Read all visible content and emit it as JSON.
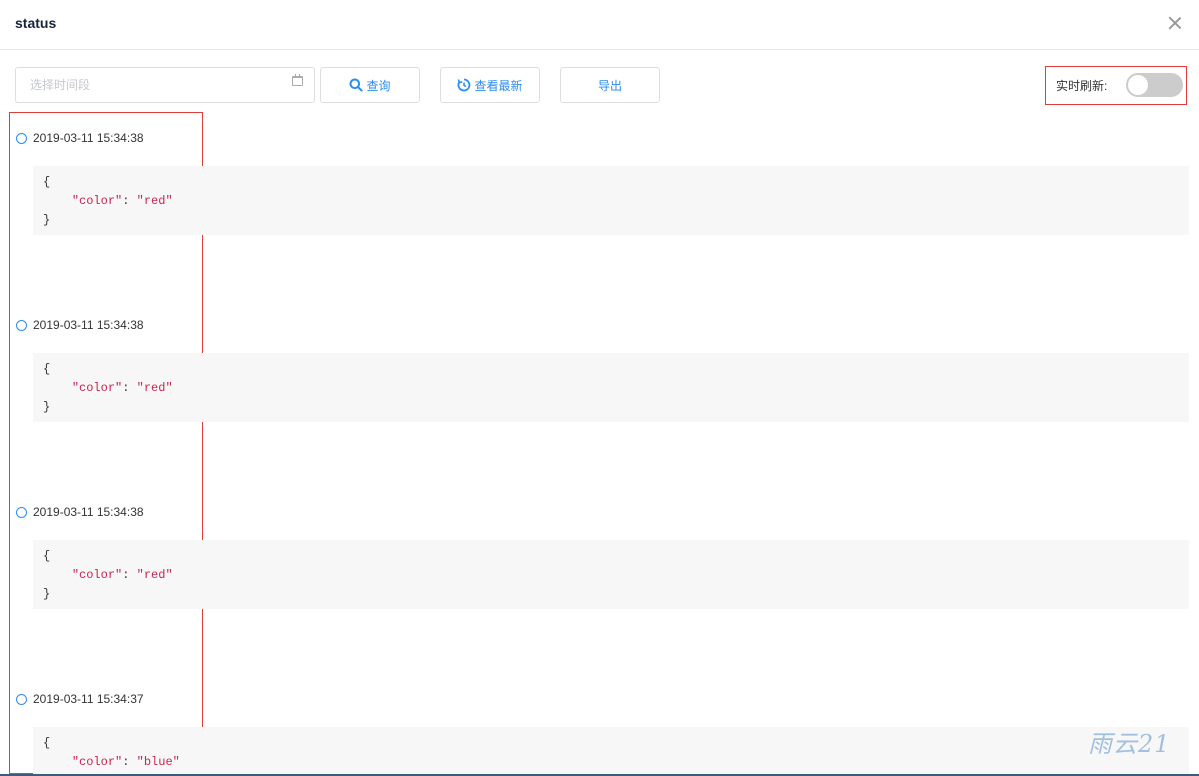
{
  "header": {
    "title": "status"
  },
  "toolbar": {
    "date_placeholder": "选择时间段",
    "query_label": "查询",
    "latest_label": "查看最新",
    "export_label": "导出",
    "realtime_label": "实时刷新:",
    "realtime_on": false
  },
  "entries": [
    {
      "time": "2019-03-11 15:34:38",
      "open": "{",
      "key": "\"color\"",
      "sep": ": ",
      "value": "\"red\"",
      "close": "}"
    },
    {
      "time": "2019-03-11 15:34:38",
      "open": "{",
      "key": "\"color\"",
      "sep": ": ",
      "value": "\"red\"",
      "close": "}"
    },
    {
      "time": "2019-03-11 15:34:38",
      "open": "{",
      "key": "\"color\"",
      "sep": ": ",
      "value": "\"red\"",
      "close": "}"
    },
    {
      "time": "2019-03-11 15:34:37",
      "open": "{",
      "key": "\"color\"",
      "sep": ": ",
      "value": "\"blue\"",
      "close": "}"
    }
  ],
  "watermark": "雨云21",
  "colors": {
    "accent": "#2d8cf0",
    "highlight": "#e03c3c",
    "json_string": "#c7254e"
  }
}
